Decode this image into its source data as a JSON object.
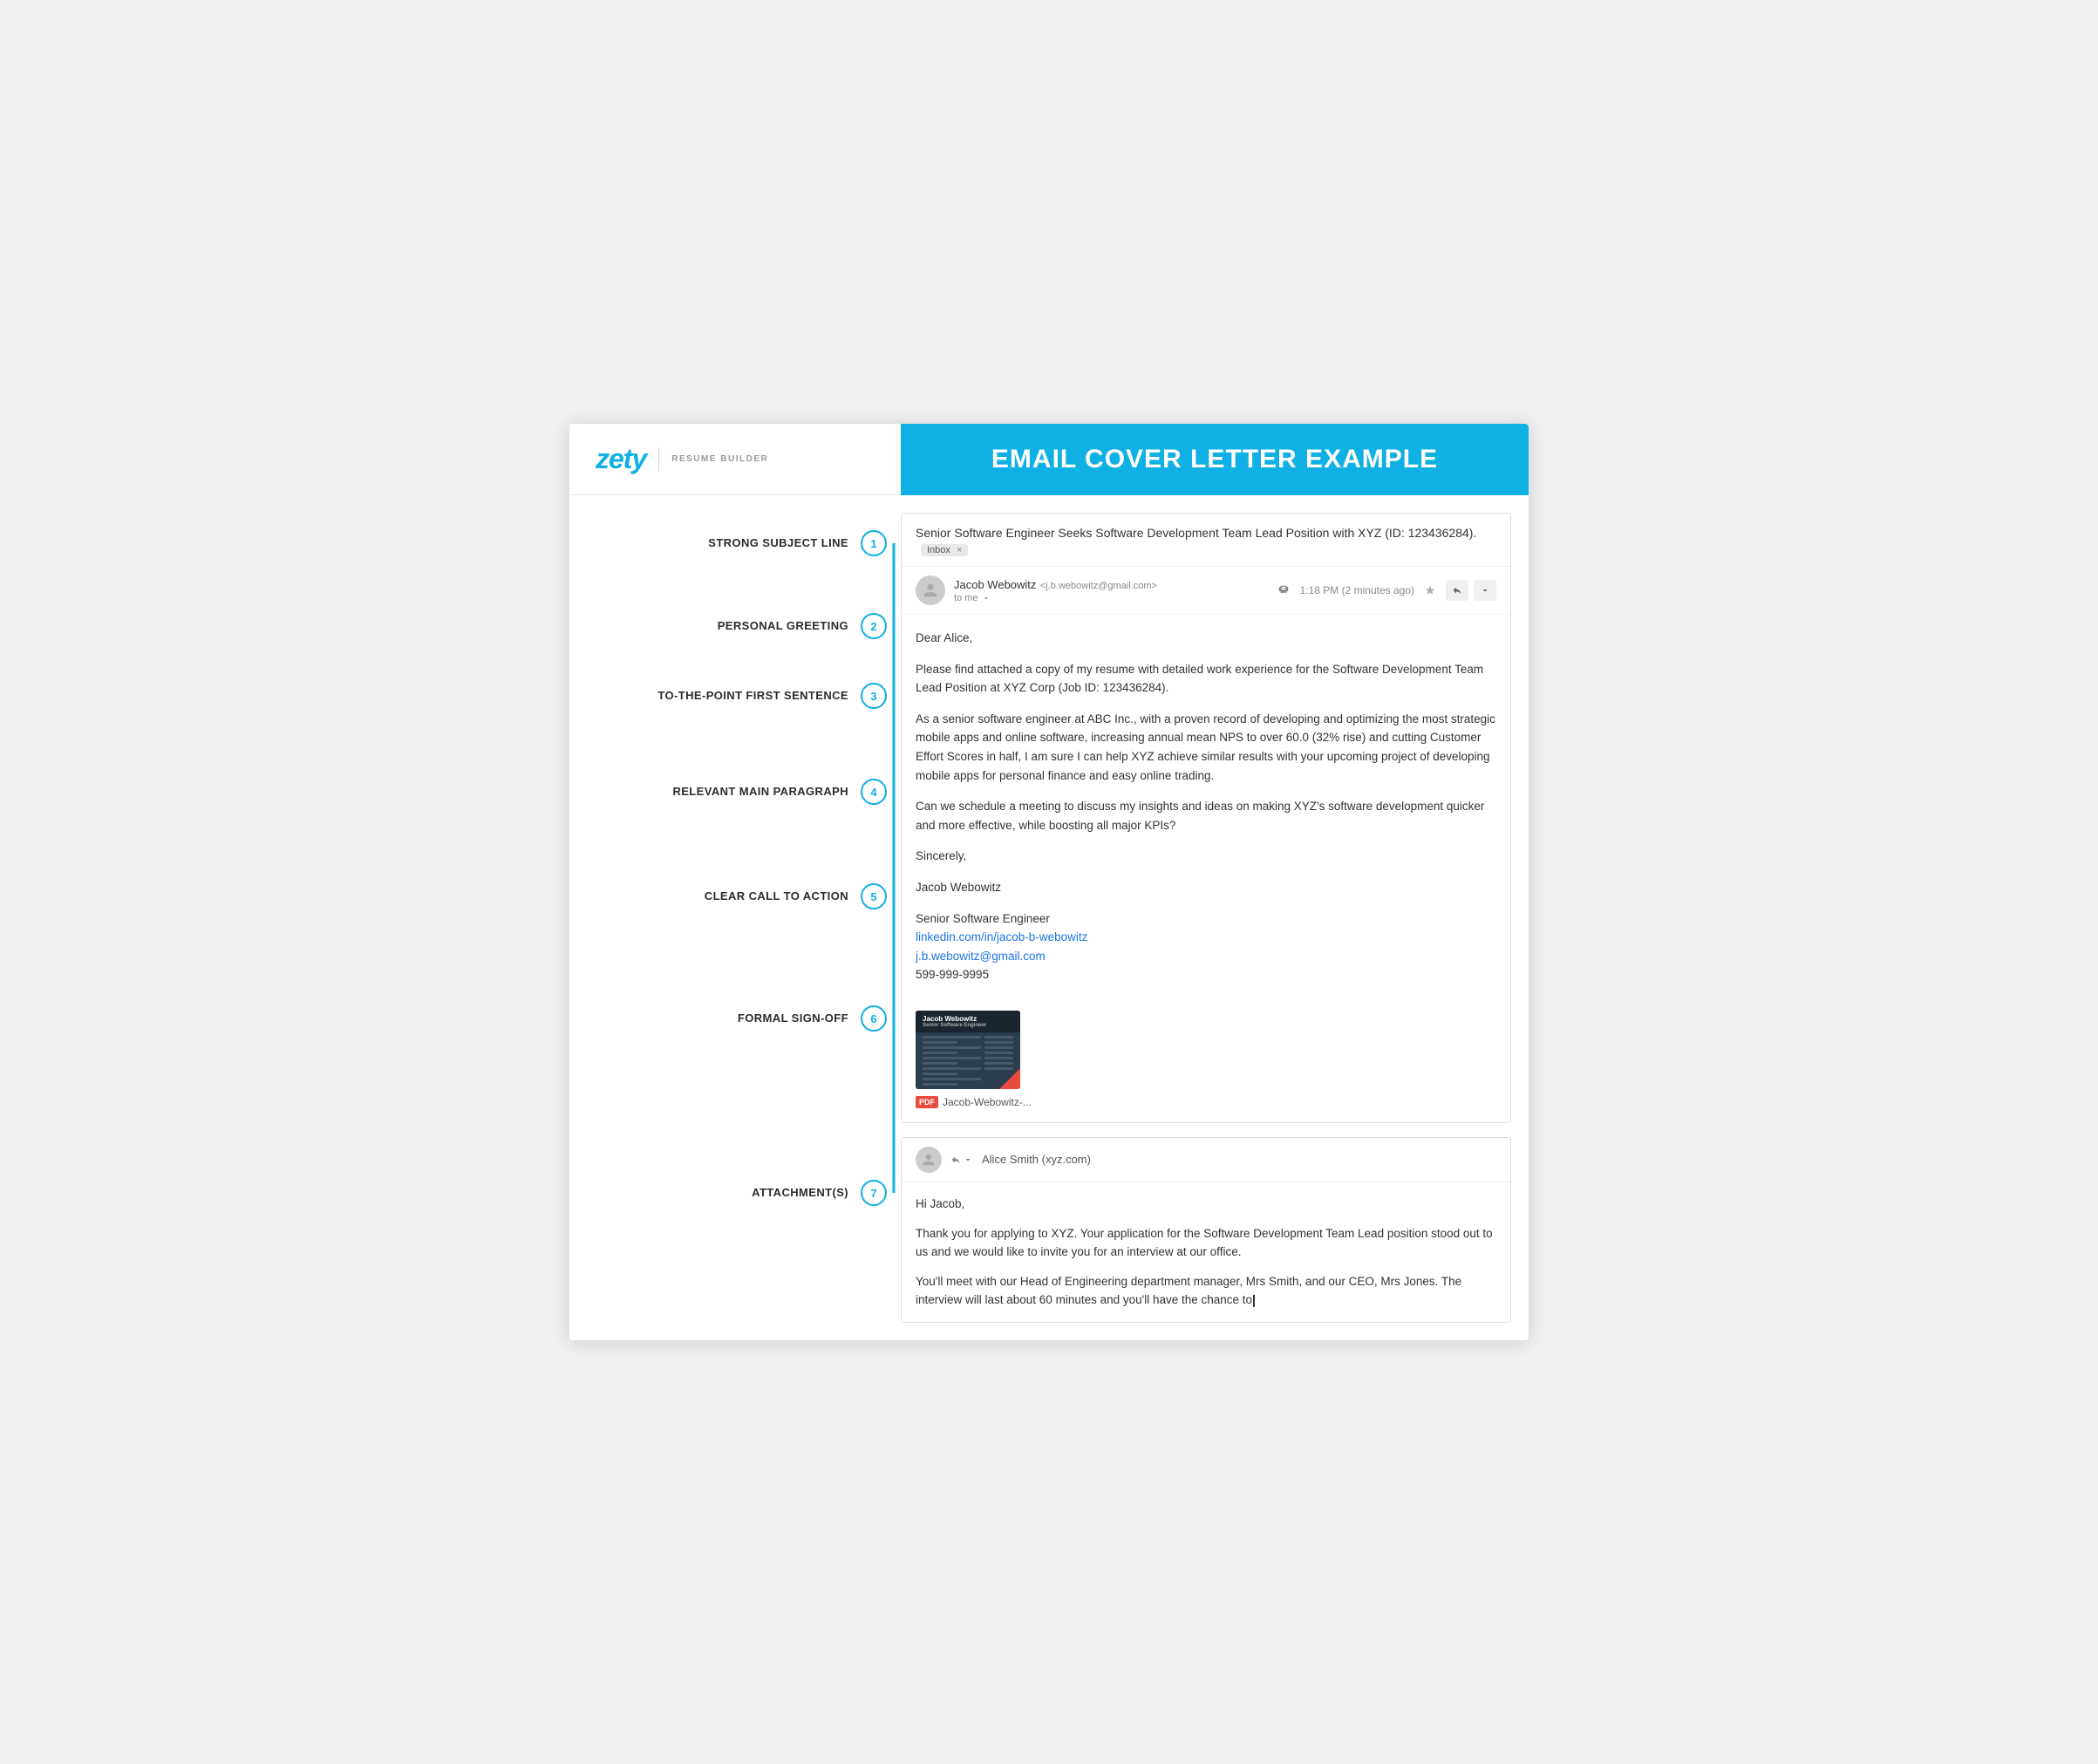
{
  "header": {
    "logo_text": "zety",
    "logo_subtitle": "RESUME BUILDER",
    "title": "EMAIL COVER LETTER EXAMPLE"
  },
  "annotations": [
    {
      "id": "1",
      "label": "STRONG SUBJECT LINE"
    },
    {
      "id": "2",
      "label": "PERSONAL GREETING"
    },
    {
      "id": "3",
      "label": "TO-THE-POINT FIRST SENTENCE"
    },
    {
      "id": "4",
      "label": "RELEVANT MAIN PARAGRAPH"
    },
    {
      "id": "5",
      "label": "CLEAR CALL TO ACTION"
    },
    {
      "id": "6",
      "label": "FORMAL SIGN-OFF"
    },
    {
      "id": "7",
      "label": "ATTACHMENT(S)"
    }
  ],
  "email": {
    "subject": "Senior Software Engineer Seeks Software Development Team Lead Position with XYZ (ID: 123436284).",
    "inbox_label": "Inbox",
    "sender_name": "Jacob Webowitz",
    "sender_email": "<j.b.webowitz@gmail.com>",
    "to_me": "to me",
    "time": "1:18 PM (2 minutes ago)",
    "greeting": "Dear Alice,",
    "body_p1": "Please find attached a copy of my resume with detailed work experience for the Software Development Team Lead Position at XYZ Corp (Job ID: 123436284).",
    "body_p2": "As a senior software engineer at ABC Inc., with a proven record of developing and optimizing the most strategic mobile apps and online software, increasing annual mean NPS to over 60.0 (32% rise) and cutting Customer Effort Scores in half, I am sure I can help XYZ achieve similar results with your upcoming project of developing mobile apps for personal finance and easy online trading.",
    "body_p3": "Can we schedule a meeting to discuss my insights and ideas on making XYZ's software development quicker and more effective, while boosting all major KPIs?",
    "signoff": "Sincerely,",
    "name": "Jacob Webowitz",
    "title_line": "Senior Software Engineer",
    "linkedin": "linkedin.com/in/jacob-b-webowitz",
    "email_link": "j.b.webowitz@gmail.com",
    "phone": "599-999-9995",
    "attachment_thumb_name": "Jacob Webowitz",
    "attachment_thumb_subtitle": "Senior Software Engineer",
    "pdf_filename": "Jacob-Webowitz-..."
  },
  "reply": {
    "sender": "Alice Smith (xyz.com)",
    "greeting": "Hi Jacob,",
    "body_p1": "Thank you for applying to XYZ. Your application for the Software Development Team Lead position stood out to us and we would like to invite you for an interview at our office.",
    "body_p2": "You'll meet with our Head of Engineering department manager, Mrs Smith, and our CEO, Mrs Jones. The interview will last about 60 minutes and you'll have the chance to"
  },
  "colors": {
    "accent": "#0fb0e3",
    "link": "#1a73e8",
    "dark": "#2c3e50",
    "red": "#e74c3c"
  }
}
